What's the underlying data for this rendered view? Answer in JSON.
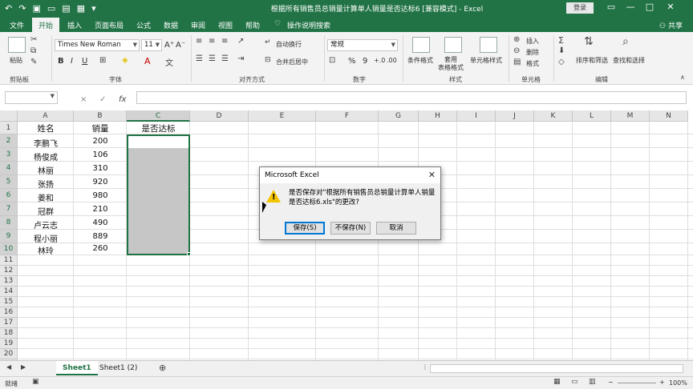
{
  "titlebar": {
    "title": "根据所有销售员总销量计算单人销量是否达标6 [兼容模式] - Excel",
    "login": "登录",
    "qat_icons": [
      "undo-icon",
      "redo-icon",
      "save-icon",
      "new-file-icon",
      "open-folder-icon",
      "print-preview-icon",
      "customize-qat-icon"
    ]
  },
  "tabs": [
    "文件",
    "开始",
    "插入",
    "页面布局",
    "公式",
    "数据",
    "审阅",
    "视图",
    "帮助"
  ],
  "active_tab": "开始",
  "tell_me": "操作说明搜索",
  "share": "共享",
  "ribbon": {
    "clipboard": {
      "paste": "粘贴",
      "group": "剪贴板"
    },
    "font": {
      "name": "Times New Roman",
      "size": "11",
      "bold": "B",
      "italic": "I",
      "underline": "U",
      "group": "字体"
    },
    "alignment": {
      "wrap": "自动换行",
      "merge": "合并后居中",
      "group": "对齐方式"
    },
    "number": {
      "format": "常规",
      "percent": "%",
      "comma": "9",
      "group": "数字"
    },
    "styles": {
      "conditional": "条件格式",
      "table": "套用\n表格格式",
      "cell_styles": "单元格样式",
      "group": "样式"
    },
    "cells": {
      "insert": "插入",
      "delete": "删除",
      "format": "格式",
      "group": "单元格"
    },
    "editing": {
      "sort": "排序和筛选",
      "find": "查找和选择",
      "group": "编辑"
    }
  },
  "formula_bar": {
    "namebox": "",
    "cancel": "×",
    "enter": "✓",
    "fx": "fx",
    "formula": ""
  },
  "columns": [
    "A",
    "B",
    "C",
    "D",
    "E",
    "F",
    "G",
    "H",
    "I",
    "J",
    "K",
    "L",
    "M",
    "N"
  ],
  "rows": [
    "1",
    "2",
    "3",
    "4",
    "5",
    "6",
    "7",
    "8",
    "9",
    "10",
    "11",
    "12",
    "13",
    "14",
    "15",
    "16",
    "17",
    "18",
    "19",
    "20",
    "21",
    "22",
    "23"
  ],
  "table": {
    "headers": [
      "姓名",
      "销量",
      "是否达标"
    ],
    "rows": [
      [
        "李鹏飞",
        "200"
      ],
      [
        "杨俊成",
        "106"
      ],
      [
        "林丽",
        "310"
      ],
      [
        "张扬",
        "920"
      ],
      [
        "姜和",
        "980"
      ],
      [
        "冠群",
        "210"
      ],
      [
        "卢云志",
        "490"
      ],
      [
        "程小丽",
        "889"
      ],
      [
        "林玲",
        "260"
      ]
    ]
  },
  "sheets": [
    "Sheet1",
    "Sheet1 (2)"
  ],
  "active_sheet": "Sheet1",
  "status": {
    "ready": "就绪",
    "zoom": "100%"
  },
  "dialog": {
    "title": "Microsoft Excel",
    "message": "是否保存对\"根据所有销售员总销量计算单人销量是否达标6.xls\"的更改?",
    "buttons": [
      "保存(S)",
      "不保存(N)",
      "取消"
    ]
  }
}
